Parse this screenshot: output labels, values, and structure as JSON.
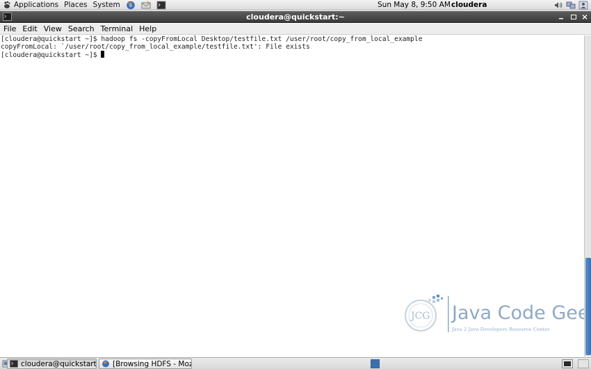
{
  "top_panel": {
    "menus": [
      "Applications",
      "Places",
      "System"
    ],
    "launchers": [
      "firefox-icon",
      "mail-icon",
      "terminal-icon"
    ],
    "clock": "Sun May  8,  9:50 AM",
    "user": "cloudera"
  },
  "window": {
    "title": "cloudera@quickstart:~"
  },
  "menubar": {
    "items": [
      "File",
      "Edit",
      "View",
      "Search",
      "Terminal",
      "Help"
    ]
  },
  "terminal": {
    "lines": [
      "[cloudera@quickstart ~]$ hadoop fs -copyFromLocal Desktop/testfile.txt /user/root/copy_from_local_example",
      "copyFromLocal: `/user/root/copy_from_local_example/testfile.txt': File exists",
      "[cloudera@quickstart ~]$ "
    ]
  },
  "watermark": {
    "logo_text": "Java Code Geeks",
    "tagline": "Java 2 Java Developers Resource Center"
  },
  "taskbar": {
    "tasks": [
      "cloudera@quickstart:~",
      "[Browsing HDFS - Mozi..."
    ]
  },
  "colors": {
    "titlebar": "#4a4a4a",
    "scrollbar_thumb": "#4a7fc0",
    "watermark": "#8ea9c6"
  }
}
